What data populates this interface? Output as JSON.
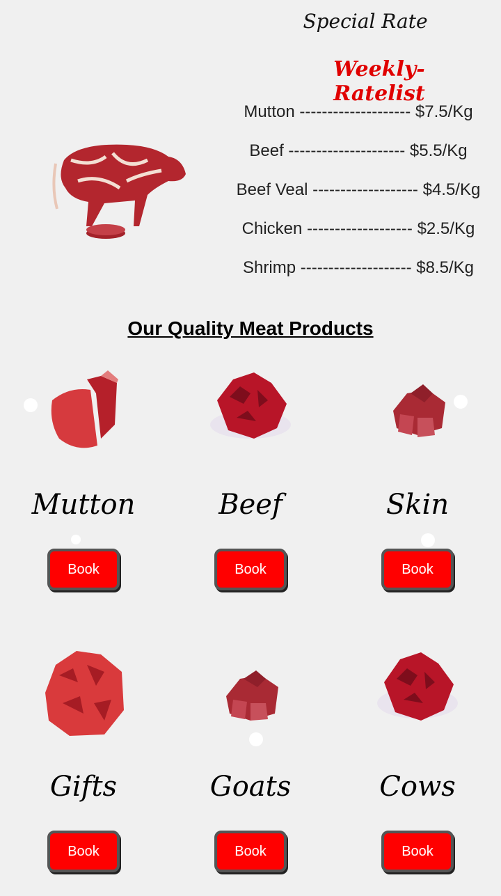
{
  "rates": {
    "title": "Special Rate",
    "subtitle": "Weekly-Ratelist",
    "items": [
      "Mutton -------------------- $7.5/Kg",
      "Beef --------------------- $5.5/Kg",
      "Beef Veal ------------------- $4.5/Kg",
      "Chicken ------------------- $2.5/Kg",
      "Shrimp -------------------- $8.5/Kg"
    ]
  },
  "products": {
    "title": "Our Quality Meat Products",
    "items": [
      {
        "name": "Mutton",
        "button": "Book",
        "icon": "mutton-meat-image"
      },
      {
        "name": "Beef",
        "button": "Book",
        "icon": "beef-meat-image"
      },
      {
        "name": "Skin",
        "button": "Book",
        "icon": "skin-meat-image"
      },
      {
        "name": "Gifts",
        "button": "Book",
        "icon": "gifts-meat-image"
      },
      {
        "name": "Goats",
        "button": "Book",
        "icon": "goats-meat-image"
      },
      {
        "name": "Cows",
        "button": "Book",
        "icon": "cows-meat-image"
      }
    ]
  },
  "colors": {
    "accent": "#ff0000",
    "subtitle": "#e00000",
    "background": "#f0f0f0"
  }
}
